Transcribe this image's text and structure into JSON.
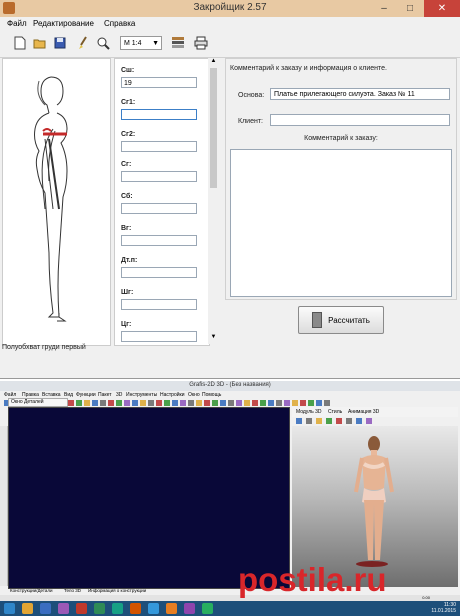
{
  "window1": {
    "title": "Закройщик 2.57",
    "menu": [
      "Файл",
      "Редактирование",
      "Справка"
    ],
    "toolbar": {
      "icons": [
        "new-file-icon",
        "open-folder-icon",
        "save-disk-icon",
        "brush-icon",
        "zoom-icon",
        "print-preview-icon",
        "printer-icon"
      ],
      "scale_value": "М 1:4"
    },
    "status_text": "Полуобхват груди первый",
    "fields": [
      {
        "label": "Сш:",
        "value": "19"
      },
      {
        "label": "Сг1:",
        "value": ""
      },
      {
        "label": "Сг2:",
        "value": ""
      },
      {
        "label": "Сг:",
        "value": ""
      },
      {
        "label": "Сб:",
        "value": ""
      },
      {
        "label": "Вг:",
        "value": ""
      },
      {
        "label": "Дт.п:",
        "value": ""
      },
      {
        "label": "Шг:",
        "value": ""
      },
      {
        "label": "Цг:",
        "value": ""
      }
    ],
    "comment_group": {
      "caption": "Комментарий к заказу и информация о клиенте.",
      "basis_label": "Основа:",
      "basis_value": "Платье прилегающего силуэта. Заказ № 11",
      "client_label": "Клиент:",
      "client_value": "",
      "comment_title": "Комментарий к заказу:"
    },
    "calc_button": "Рассчитать"
  },
  "window2": {
    "title": "Grafis-2D 3D - (Без названия)",
    "menu": [
      "Файл",
      "Правка",
      "Вставка",
      "Вид",
      "Функции",
      "Пакет",
      "3D",
      "Инструменты",
      "Настройки",
      "Окно",
      "Помощь"
    ],
    "canvas_tab": "Окно Деталей",
    "view_tabs": [
      "Модуль 3D",
      "Стиль",
      "Анимация 3D"
    ],
    "bottom_tabs": [
      "Конструкции/Детали",
      "Тело 3D",
      "Информация о конструкции"
    ],
    "status_value": "0.00"
  },
  "taskbar": {
    "time": "11:30",
    "date": "11.01.2015"
  },
  "watermark": "postila.ru"
}
